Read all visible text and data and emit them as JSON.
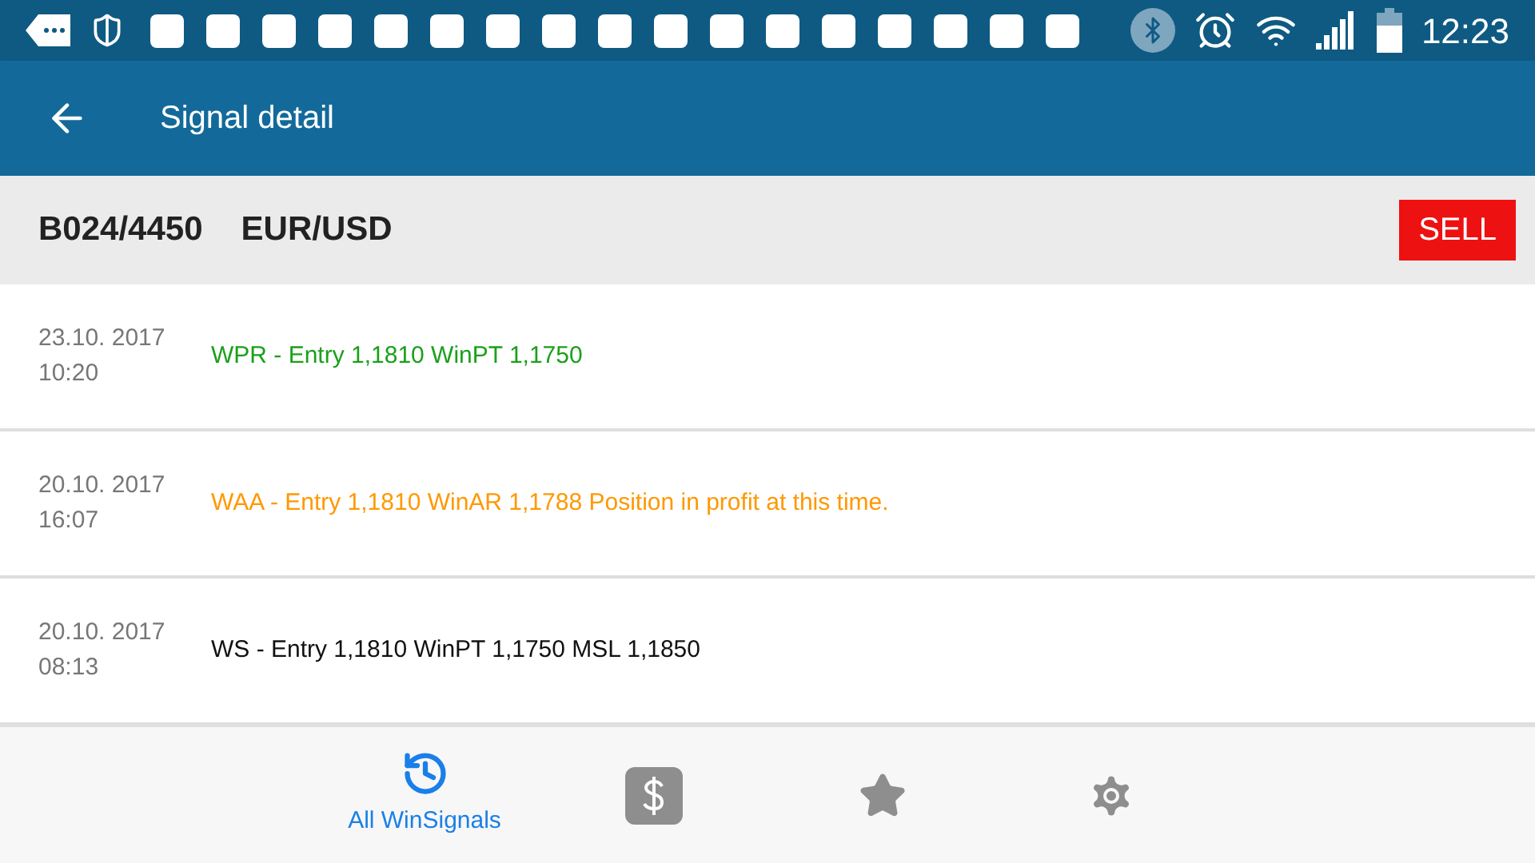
{
  "status_bar": {
    "time": "12:23"
  },
  "app_bar": {
    "title": "Signal detail"
  },
  "signal": {
    "code": "B024/4450",
    "pair": "EUR/USD",
    "action": "SELL"
  },
  "entries": [
    {
      "date": "23.10. 2017",
      "time": "10:20",
      "text": "WPR - Entry 1,1810 WinPT 1,1750",
      "color": "#1aa01a"
    },
    {
      "date": "20.10. 2017",
      "time": "16:07",
      "text": "WAA - Entry 1,1810 WinAR 1,1788 Position in profit at this time.",
      "color": "#ff9800"
    },
    {
      "date": "20.10. 2017",
      "time": "08:13",
      "text": "WS - Entry 1,1810 WinPT 1,1750 MSL 1,1850",
      "color": "#111111"
    }
  ],
  "tabs": [
    {
      "kind": "history",
      "label": "All WinSignals",
      "selected": true
    },
    {
      "kind": "dollar",
      "selected": false
    },
    {
      "kind": "star",
      "selected": false
    },
    {
      "kind": "settings",
      "selected": false
    }
  ]
}
